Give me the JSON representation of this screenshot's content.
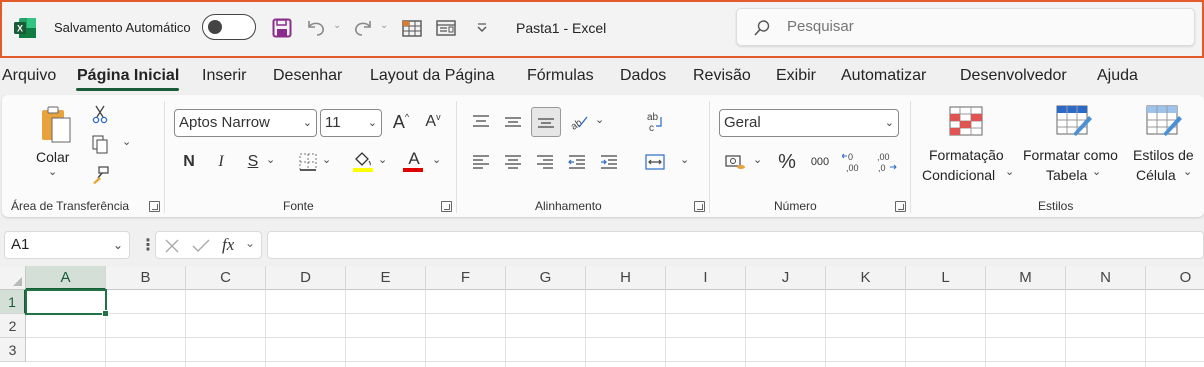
{
  "titlebar": {
    "autosave_label": "Salvamento Automático",
    "document_title": "Pasta1  -  Excel",
    "search_placeholder": "Pesquisar",
    "accent_color": "#e35a2b"
  },
  "menu": {
    "tabs": [
      "Arquivo",
      "Página Inicial",
      "Inserir",
      "Desenhar",
      "Layout da Página",
      "Fórmulas",
      "Dados",
      "Revisão",
      "Exibir",
      "Automatizar",
      "Desenvolvedor",
      "Ajuda"
    ],
    "active": "Página Inicial"
  },
  "ribbon": {
    "clipboard": {
      "paste_label": "Colar",
      "group": "Área de Transferência"
    },
    "font": {
      "family": "Aptos Narrow",
      "size": "11",
      "group": "Fonte",
      "bold": "N",
      "italic": "I",
      "underline": "S",
      "grow": "A",
      "shrink": "A",
      "font_color": "A",
      "highlight_color": "#ffff00",
      "text_color": "#e00000"
    },
    "alignment": {
      "group": "Alinhamento"
    },
    "number": {
      "format": "Geral",
      "group": "Número",
      "percent": "%",
      "thousands": "000"
    },
    "styles": {
      "group": "Estilos",
      "conditional_line1": "Formatação",
      "conditional_line2": "Condicional",
      "table_line1": "Formatar como",
      "table_line2": "Tabela",
      "cell_line1": "Estilos de",
      "cell_line2": "Célula"
    }
  },
  "formula_bar": {
    "name_box": "A1",
    "fx": "fx",
    "formula": ""
  },
  "sheet": {
    "columns": [
      "A",
      "B",
      "C",
      "D",
      "E",
      "F",
      "G",
      "H",
      "I",
      "J",
      "K",
      "L",
      "M",
      "N",
      "O"
    ],
    "rows": [
      "1",
      "2",
      "3"
    ],
    "active_cell": "A1",
    "accent": "#217346"
  }
}
